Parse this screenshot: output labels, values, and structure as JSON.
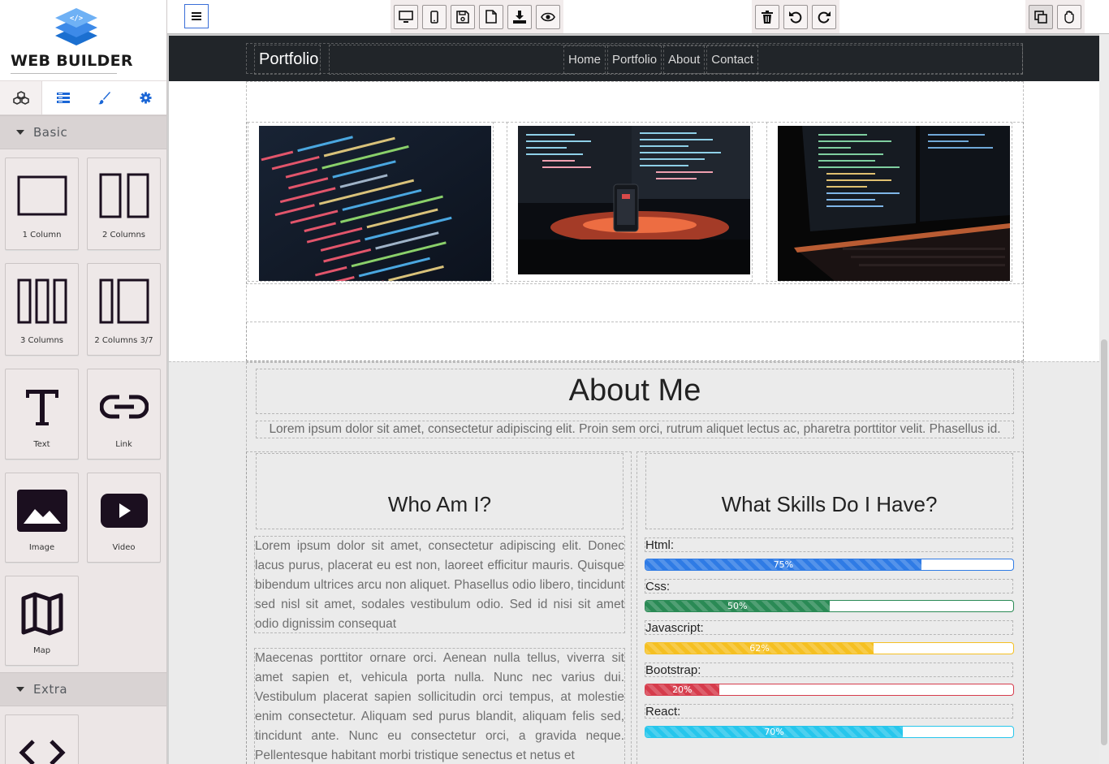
{
  "app": {
    "brand_name": "WEB BUILDER",
    "panel_tabs": [
      "blocks-icon",
      "layers-icon",
      "style-brush-icon",
      "settings-gear-icon"
    ],
    "categories": {
      "basic": "Basic",
      "extra": "Extra"
    },
    "blocks": [
      {
        "label": "1 Column",
        "icon": "one-column-icon"
      },
      {
        "label": "2 Columns",
        "icon": "two-columns-icon"
      },
      {
        "label": "3 Columns",
        "icon": "three-columns-icon"
      },
      {
        "label": "2 Columns 3/7",
        "icon": "two-columns-37-icon"
      },
      {
        "label": "Text",
        "icon": "text-icon"
      },
      {
        "label": "Link",
        "icon": "link-icon"
      },
      {
        "label": "Image",
        "icon": "image-icon"
      },
      {
        "label": "Video",
        "icon": "video-icon"
      },
      {
        "label": "Map",
        "icon": "map-icon"
      }
    ],
    "extra_blocks": [
      {
        "icon": "code-icon"
      }
    ],
    "toolbar": {
      "device_buttons": [
        "desktop-icon",
        "mobile-icon"
      ],
      "file_buttons": [
        "save-icon",
        "new-page-icon",
        "download-icon",
        "preview-eye-icon"
      ],
      "history_buttons": [
        "trash-icon",
        "undo-icon",
        "redo-icon"
      ],
      "view_buttons": [
        "component-outline-icon",
        "hand-icon"
      ]
    }
  },
  "site": {
    "nav": {
      "brand": "Portfolio",
      "links": [
        "Home",
        "Portfolio",
        "About",
        "Contact"
      ]
    },
    "portfolio_images": [
      "code-screenshot-image",
      "monitors-phone-image",
      "keyboard-monitor-image"
    ],
    "about": {
      "title": "About Me",
      "lead": "Lorem ipsum dolor sit amet, consectetur adipiscing elit. Proin sem orci, rutrum aliquet lectus ac, pharetra porttitor velit. Phasellus id.",
      "who_title": "Who Am I?",
      "who_p1": "Lorem ipsum dolor sit amet, consectetur adipiscing elit. Donec lacus purus, placerat eu est non, laoreet efficitur mauris. Quisque bibendum ultrices arcu non aliquet. Phasellus odio libero, tincidunt sed nisl sit amet, sodales vestibulum odio. Sed id nisi sit amet odio dignissim consequat",
      "who_p2": "Maecenas porttitor ornare orci. Aenean nulla tellus, viverra sit amet sapien et, vehicula porta nulla. Nunc nec varius dui. Vestibulum placerat sapien sollicitudin orci tempus, at molestie enim consectetur. Aliquam sed purus blandit, aliquam felis sed, tincidunt ante. Nunc eu consectetur orci, a gravida neque. Pellentesque habitant morbi tristique senectus et netus et",
      "skills_title": "What Skills Do I Have?",
      "skills": [
        {
          "name": "Html:",
          "percent": 75,
          "label": "75%",
          "color": "#2f7be5"
        },
        {
          "name": "Css:",
          "percent": 50,
          "label": "50%",
          "color": "#2a8a55"
        },
        {
          "name": "Javascript:",
          "percent": 62,
          "label": "62%",
          "color": "#f5c022"
        },
        {
          "name": "Bootstrap:",
          "percent": 20,
          "label": "20%",
          "color": "#d63c4c"
        },
        {
          "name": "React:",
          "percent": 70,
          "label": "70%",
          "color": "#26c6ec"
        }
      ]
    }
  }
}
